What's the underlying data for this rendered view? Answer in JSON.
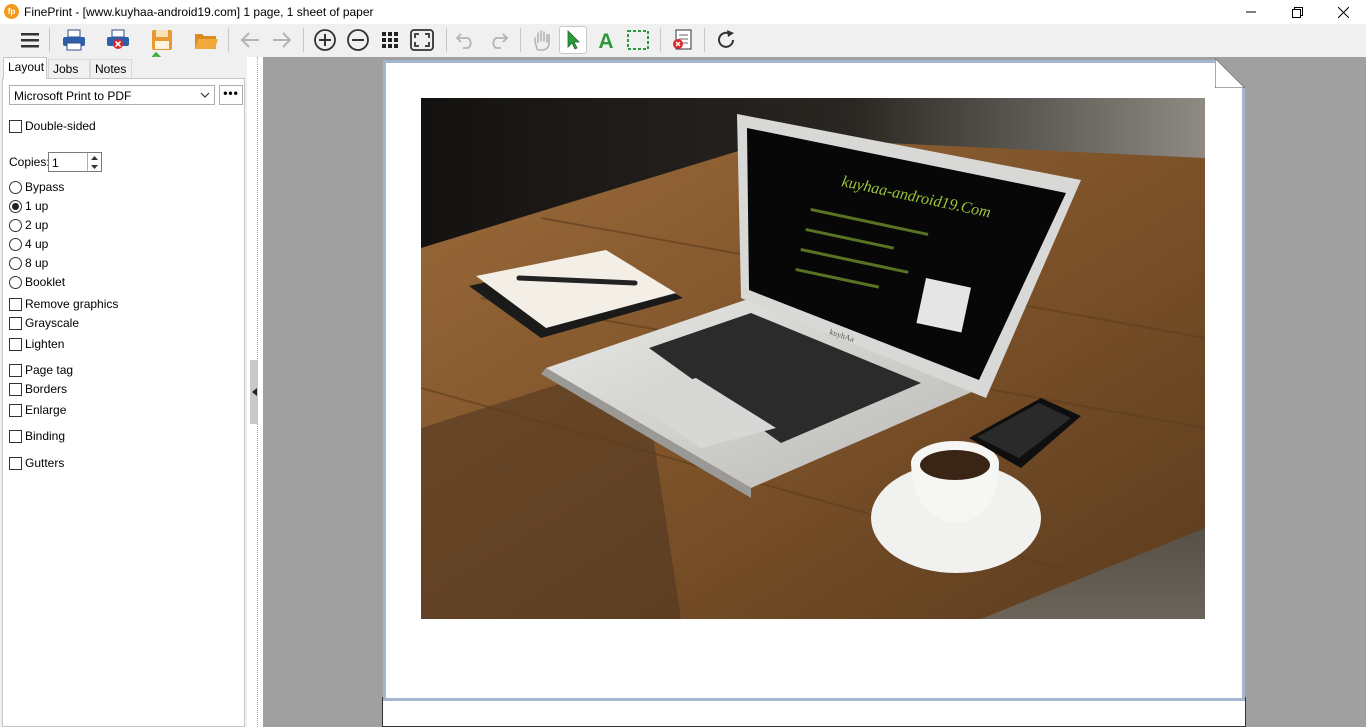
{
  "window": {
    "title": "FinePrint - [www.kuyhaa-android19.com] 1 page, 1 sheet of paper",
    "app_icon_text": "fp"
  },
  "toolbar": {
    "buttons": [
      "menu",
      "print",
      "print-delete",
      "save",
      "open",
      "back",
      "forward",
      "zoom-in",
      "zoom-out",
      "grid-view",
      "fit-page",
      "undo",
      "redo",
      "hand-tool",
      "select-tool",
      "text-tool",
      "crop-tool",
      "delete-page",
      "refresh"
    ],
    "active_tool": "select-tool"
  },
  "watermark": {
    "text": "kuyhaa-android19",
    "color": "#3cb043"
  },
  "panel": {
    "tabs": [
      {
        "label": "Layout"
      },
      {
        "label": "Jobs"
      },
      {
        "label": "Notes"
      }
    ],
    "active_tab": "Layout",
    "printer": "Microsoft Print to PDF",
    "more_label": "•••",
    "double_sided": {
      "label": "Double-sided",
      "checked": false
    },
    "copies": {
      "label": "Copies:",
      "value": "1"
    },
    "layouts": [
      {
        "label": "Bypass",
        "selected": false
      },
      {
        "label": "1 up",
        "selected": true
      },
      {
        "label": "2 up",
        "selected": false
      },
      {
        "label": "4 up",
        "selected": false
      },
      {
        "label": "8 up",
        "selected": false
      },
      {
        "label": "Booklet",
        "selected": false
      }
    ],
    "options": [
      {
        "label": "Remove graphics",
        "checked": false
      },
      {
        "label": "Grayscale",
        "checked": false
      },
      {
        "label": "Lighten",
        "checked": false
      },
      {
        "label": "Page tag",
        "checked": false
      },
      {
        "label": "Borders",
        "checked": false
      },
      {
        "label": "Enlarge",
        "checked": false
      },
      {
        "label": "Binding",
        "checked": false
      },
      {
        "label": "Gutters",
        "checked": false
      }
    ]
  },
  "preview": {
    "background": "#a0a0a0",
    "photo_screen_text": "kuyhaa-android19.Com",
    "laptop_brand_text": "kuyhAa"
  }
}
